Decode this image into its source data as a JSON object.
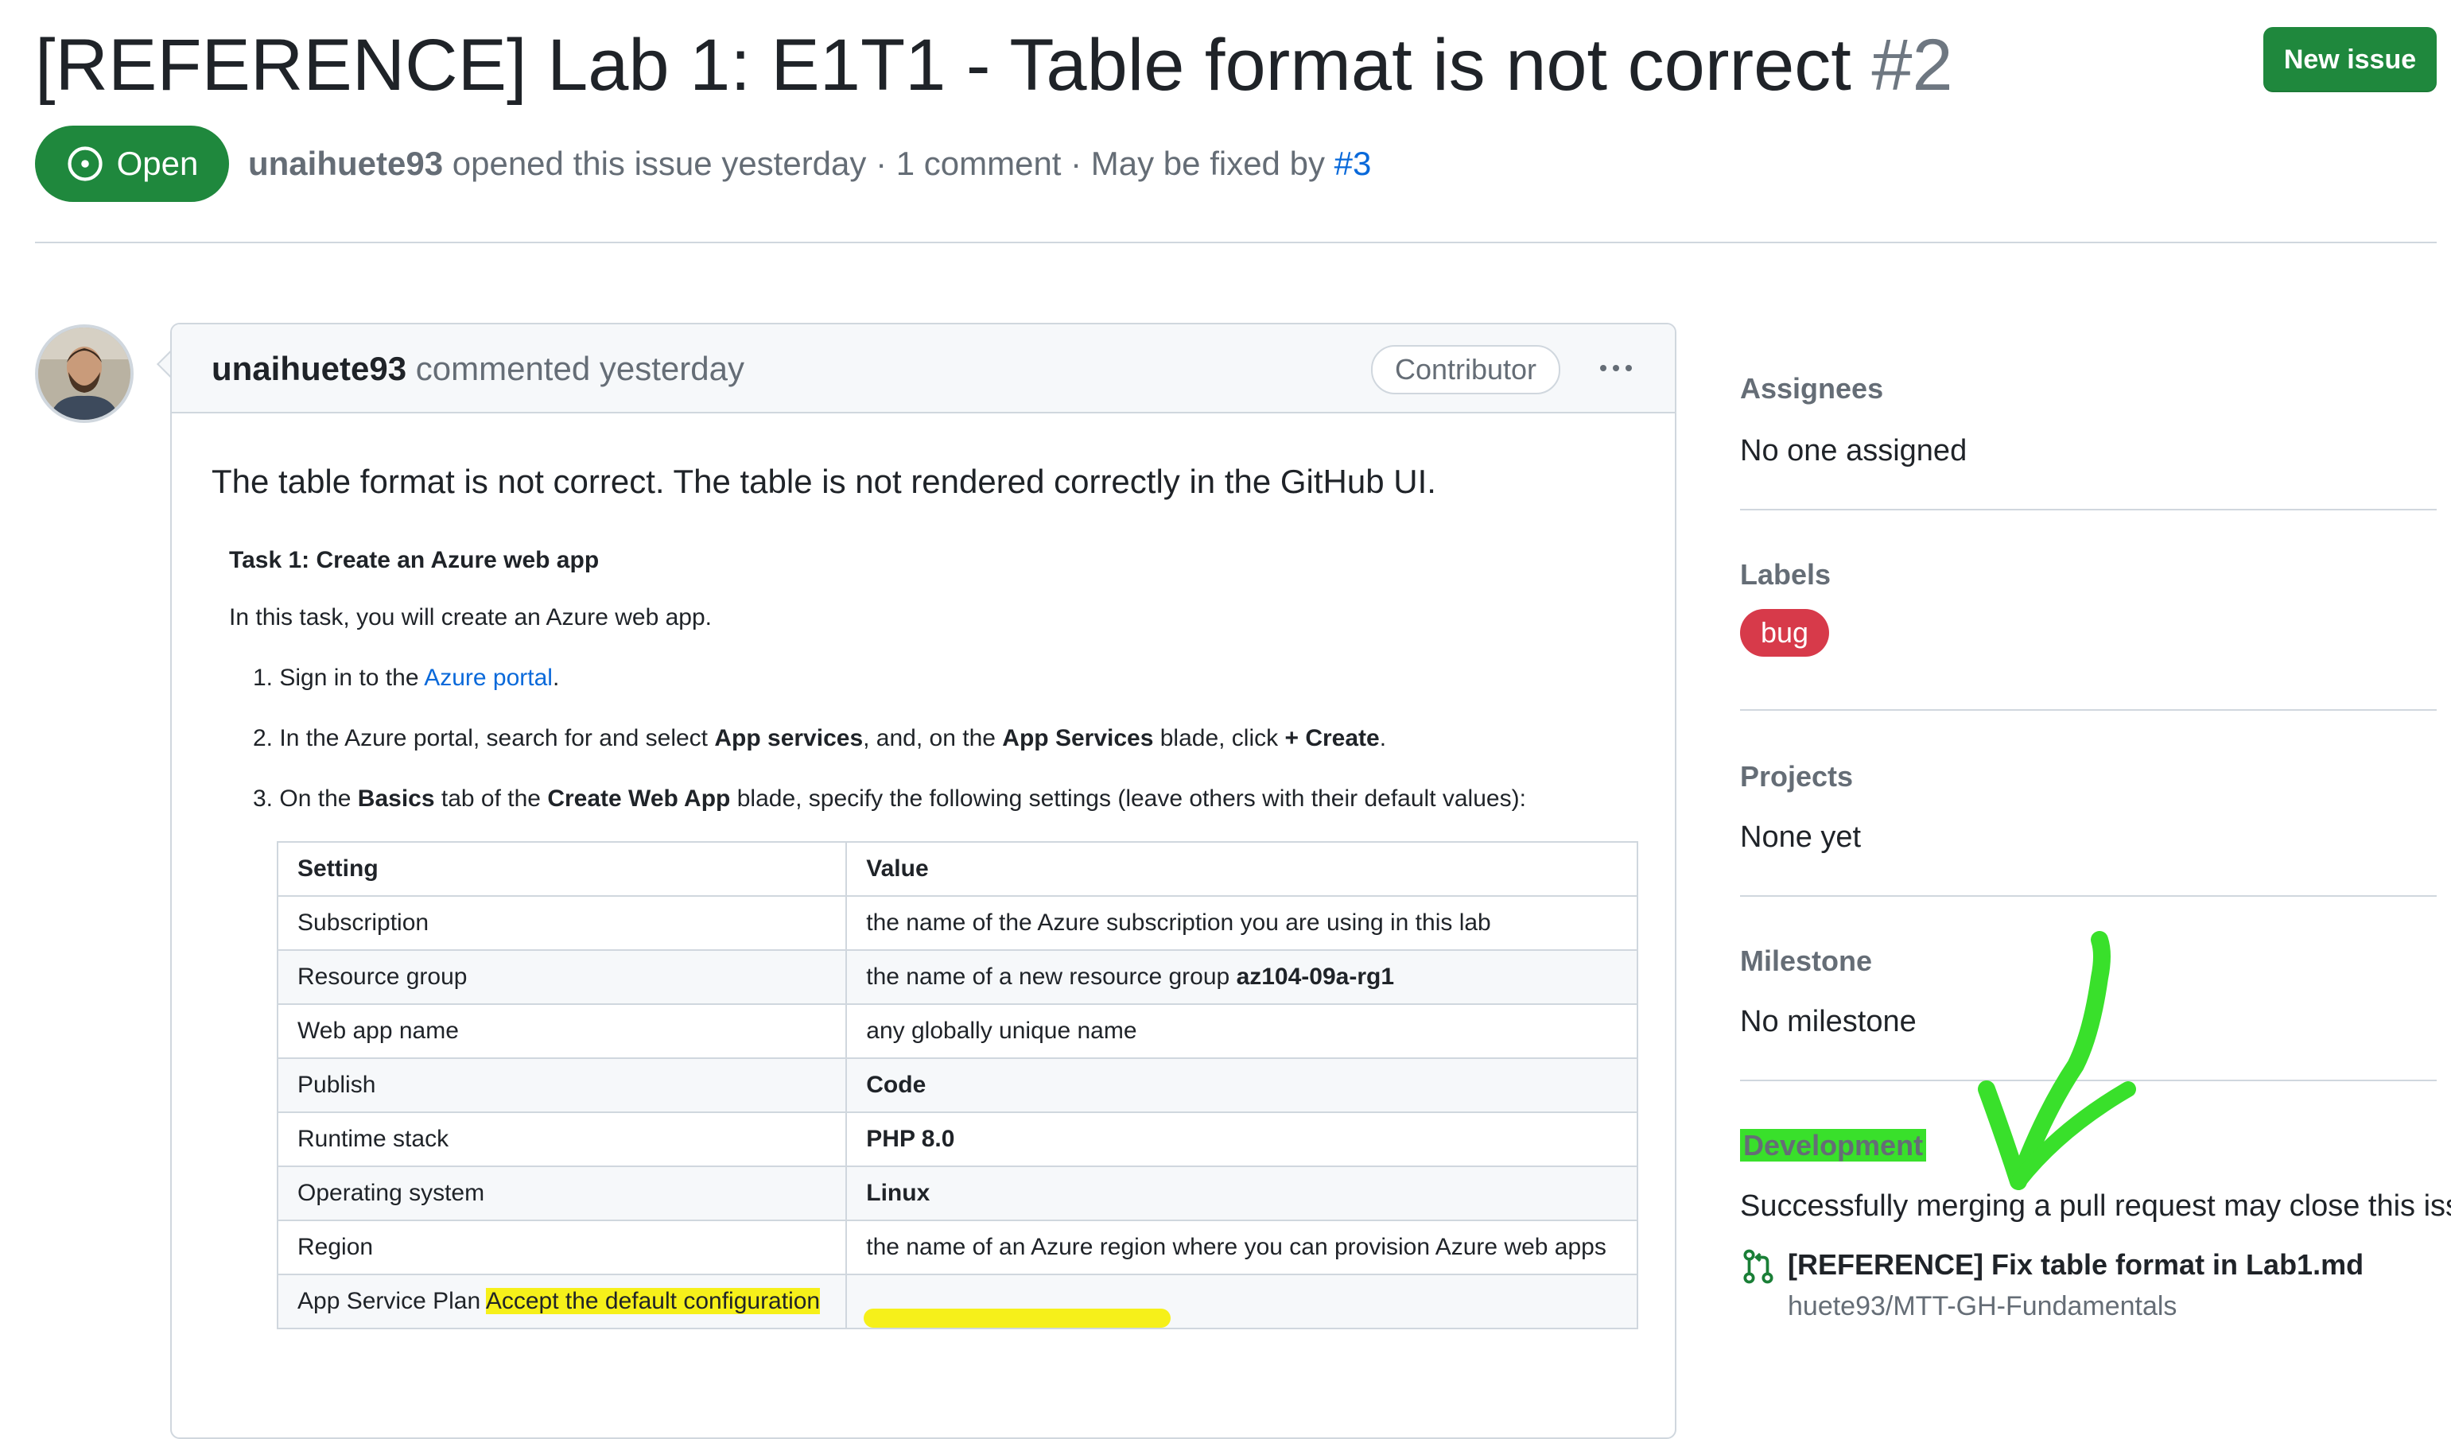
{
  "issue": {
    "title": "[REFERENCE] Lab 1: E1T1 - Table format is not correct",
    "number": "#2",
    "new_issue_label": "New issue",
    "state": "Open",
    "author": "unaihuete93",
    "meta_opened": "opened this issue yesterday · 1 comment · May be fixed by",
    "fixed_by_link": "#3"
  },
  "comment": {
    "author": "unaihuete93",
    "action": "commented yesterday",
    "badge": "Contributor",
    "lead": "The table format is not correct. The table is not rendered correctly in the GitHub UI.",
    "task_heading": "Task 1: Create an Azure web app",
    "task_intro": "In this task, you will create an Azure web app.",
    "steps": [
      {
        "num": "1.",
        "pre": "Sign in to the",
        "link": "Azure portal",
        "post": "."
      },
      {
        "num": "2.",
        "a": "In the Azure portal, search for and select",
        "b": "App services",
        "c": ", and, on the",
        "d": "App Services",
        "e": "blade, click",
        "f": "+ Create",
        "g": "."
      },
      {
        "num": "3.",
        "a": "On the",
        "b": "Basics",
        "c": "tab of the",
        "d": "Create Web App",
        "e": "blade, specify the following settings (leave others with their default values):"
      }
    ],
    "table": {
      "headers": [
        "Setting",
        "Value"
      ],
      "rows": [
        {
          "setting": "Subscription",
          "value": "the name of the Azure subscription you are using in this lab"
        },
        {
          "setting": "Resource group",
          "value_pre": "the name of a new resource group",
          "value_bold": "az104-09a-rg1"
        },
        {
          "setting": "Web app name",
          "value": "any globally unique name"
        },
        {
          "setting": "Publish",
          "value_bold": "Code"
        },
        {
          "setting": "Runtime stack",
          "value_bold": "PHP 8.0"
        },
        {
          "setting": "Operating system",
          "value_bold": "Linux"
        },
        {
          "setting": "Region",
          "value": "the name of an Azure region where you can provision Azure web apps"
        },
        {
          "setting": "App Service Plan",
          "setting_highlight": "Accept the default configuration",
          "value": ""
        }
      ]
    }
  },
  "sidebar": {
    "assignees": {
      "heading": "Assignees",
      "value": "No one assigned"
    },
    "labels": {
      "heading": "Labels",
      "items": [
        "bug"
      ]
    },
    "projects": {
      "heading": "Projects",
      "value": "None yet"
    },
    "milestone": {
      "heading": "Milestone",
      "value": "No milestone"
    },
    "development": {
      "heading": "Development",
      "note": "Successfully merging a pull request may close this issue.",
      "pr_title": "[REFERENCE] Fix table format in Lab1.md",
      "pr_repo": "huete93/MTT-GH-Fundamentals"
    }
  },
  "colors": {
    "open_green": "#1f883d",
    "bug_red": "#d73a4a",
    "highlight_yellow": "#f6f01a",
    "highlight_green": "#39e02b",
    "link_blue": "#0969da"
  }
}
